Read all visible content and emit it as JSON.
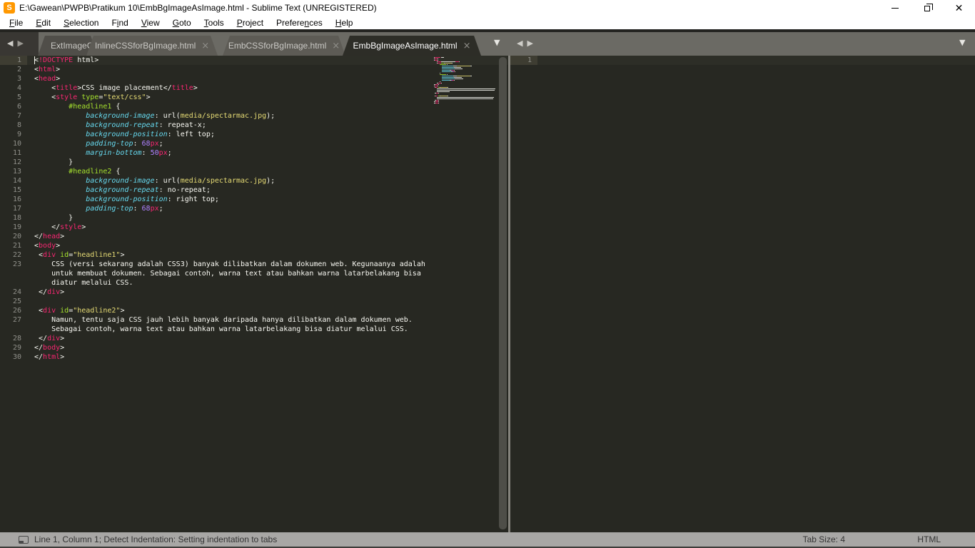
{
  "window": {
    "title": "E:\\Gawean\\PWPB\\Pratikum 10\\EmbBgImageAsImage.html - Sublime Text (UNREGISTERED)",
    "app_icon_letter": "S"
  },
  "icons": {
    "back": "◀",
    "forward": "▶",
    "dropdown": "▼",
    "close": "×"
  },
  "menu": {
    "items": [
      {
        "label": "File",
        "underline": 0
      },
      {
        "label": "Edit",
        "underline": 0
      },
      {
        "label": "Selection",
        "underline": 0
      },
      {
        "label": "Find",
        "underline": 1
      },
      {
        "label": "View",
        "underline": 0
      },
      {
        "label": "Goto",
        "underline": 0
      },
      {
        "label": "Tools",
        "underline": 0
      },
      {
        "label": "Project",
        "underline": 0
      },
      {
        "label": "Preferences",
        "underline": 7
      },
      {
        "label": "Help",
        "underline": 0
      }
    ]
  },
  "tabs": {
    "items": [
      {
        "label": "ExtImageCS",
        "active": false,
        "close_visible": false
      },
      {
        "label": "InlineCSSforBgImage.html",
        "active": false,
        "close_visible": true
      },
      {
        "label": "EmbCSSforBgImage.html",
        "active": false,
        "close_visible": true
      },
      {
        "label": "EmbBgImageAsImage.html",
        "active": true,
        "close_visible": true
      }
    ]
  },
  "editor": {
    "colors": {
      "w": "#f8f8f2",
      "p": "#f92672",
      "g": "#a6e22e",
      "y": "#e6db74",
      "c": "#66d9ef",
      "n": "#ae81ff"
    },
    "rows": [
      {
        "num": "1",
        "current": true,
        "cursor": true,
        "tokens": [
          [
            "w",
            "<"
          ],
          [
            "p",
            "!DOCTYPE"
          ],
          [
            "w",
            " html>"
          ]
        ]
      },
      {
        "num": "2",
        "tokens": [
          [
            "w",
            "<"
          ],
          [
            "p",
            "html"
          ],
          [
            "w",
            ">"
          ]
        ]
      },
      {
        "num": "3",
        "tokens": [
          [
            "w",
            "<"
          ],
          [
            "p",
            "head"
          ],
          [
            "w",
            ">"
          ]
        ]
      },
      {
        "num": "4",
        "tokens": [
          [
            "w",
            "    <"
          ],
          [
            "p",
            "title"
          ],
          [
            "w",
            ">CSS image placement</"
          ],
          [
            "p",
            "title"
          ],
          [
            "w",
            ">"
          ]
        ]
      },
      {
        "num": "5",
        "tokens": [
          [
            "w",
            "    <"
          ],
          [
            "p",
            "style"
          ],
          [
            "w",
            " "
          ],
          [
            "g",
            "type"
          ],
          [
            "w",
            "="
          ],
          [
            "y",
            "\"text/css\""
          ],
          [
            "w",
            ">"
          ]
        ]
      },
      {
        "num": "6",
        "tokens": [
          [
            "w",
            "        "
          ],
          [
            "g",
            "#headline1"
          ],
          [
            "w",
            " {"
          ]
        ]
      },
      {
        "num": "7",
        "tokens": [
          [
            "w",
            "            "
          ],
          [
            "c",
            "background-image"
          ],
          [
            "w",
            ": url("
          ],
          [
            "y",
            "media/spectarmac.jpg"
          ],
          [
            "w",
            ");"
          ]
        ]
      },
      {
        "num": "8",
        "tokens": [
          [
            "w",
            "            "
          ],
          [
            "c",
            "background-repeat"
          ],
          [
            "w",
            ": repeat-x;"
          ]
        ]
      },
      {
        "num": "9",
        "tokens": [
          [
            "w",
            "            "
          ],
          [
            "c",
            "background-position"
          ],
          [
            "w",
            ": left top;"
          ]
        ]
      },
      {
        "num": "10",
        "tokens": [
          [
            "w",
            "            "
          ],
          [
            "c",
            "padding-top"
          ],
          [
            "w",
            ": "
          ],
          [
            "n",
            "68"
          ],
          [
            "p",
            "px"
          ],
          [
            "w",
            ";"
          ]
        ]
      },
      {
        "num": "11",
        "tokens": [
          [
            "w",
            "            "
          ],
          [
            "c",
            "margin-bottom"
          ],
          [
            "w",
            ": "
          ],
          [
            "n",
            "50"
          ],
          [
            "p",
            "px"
          ],
          [
            "w",
            ";"
          ]
        ]
      },
      {
        "num": "12",
        "tokens": [
          [
            "w",
            "        }"
          ]
        ]
      },
      {
        "num": "13",
        "tokens": [
          [
            "w",
            "        "
          ],
          [
            "g",
            "#headline2"
          ],
          [
            "w",
            " {"
          ]
        ]
      },
      {
        "num": "14",
        "tokens": [
          [
            "w",
            "            "
          ],
          [
            "c",
            "background-image"
          ],
          [
            "w",
            ": url("
          ],
          [
            "y",
            "media/spectarmac.jpg"
          ],
          [
            "w",
            ");"
          ]
        ]
      },
      {
        "num": "15",
        "tokens": [
          [
            "w",
            "            "
          ],
          [
            "c",
            "background-repeat"
          ],
          [
            "w",
            ": no-repeat;"
          ]
        ]
      },
      {
        "num": "16",
        "tokens": [
          [
            "w",
            "            "
          ],
          [
            "c",
            "background-position"
          ],
          [
            "w",
            ": right top;"
          ]
        ]
      },
      {
        "num": "17",
        "tokens": [
          [
            "w",
            "            "
          ],
          [
            "c",
            "padding-top"
          ],
          [
            "w",
            ": "
          ],
          [
            "n",
            "68"
          ],
          [
            "p",
            "px"
          ],
          [
            "w",
            ";"
          ]
        ]
      },
      {
        "num": "18",
        "tokens": [
          [
            "w",
            "        }"
          ]
        ]
      },
      {
        "num": "19",
        "tokens": [
          [
            "w",
            "    </"
          ],
          [
            "p",
            "style"
          ],
          [
            "w",
            ">"
          ]
        ]
      },
      {
        "num": "20",
        "tokens": [
          [
            "w",
            "</"
          ],
          [
            "p",
            "head"
          ],
          [
            "w",
            ">"
          ]
        ]
      },
      {
        "num": "21",
        "tokens": [
          [
            "w",
            "<"
          ],
          [
            "p",
            "body"
          ],
          [
            "w",
            ">"
          ]
        ]
      },
      {
        "num": "22",
        "tokens": [
          [
            "w",
            " <"
          ],
          [
            "p",
            "div"
          ],
          [
            "w",
            " "
          ],
          [
            "g",
            "id"
          ],
          [
            "w",
            "="
          ],
          [
            "y",
            "\"headline1\""
          ],
          [
            "w",
            ">"
          ]
        ]
      },
      {
        "num": "23",
        "tokens": [
          [
            "w",
            "    CSS (versi sekarang adalah CSS3) banyak dilibatkan dalam dokumen web. Kegunaanya adalah"
          ]
        ]
      },
      {
        "num": "",
        "tokens": [
          [
            "w",
            "    untuk membuat dokumen. Sebagai contoh, warna text atau bahkan warna latarbelakang bisa"
          ]
        ]
      },
      {
        "num": "",
        "tokens": [
          [
            "w",
            "    diatur melalui CSS."
          ]
        ]
      },
      {
        "num": "24",
        "tokens": [
          [
            "w",
            " </"
          ],
          [
            "p",
            "div"
          ],
          [
            "w",
            ">"
          ]
        ]
      },
      {
        "num": "25",
        "tokens": []
      },
      {
        "num": "26",
        "tokens": [
          [
            "w",
            " <"
          ],
          [
            "p",
            "div"
          ],
          [
            "w",
            " "
          ],
          [
            "g",
            "id"
          ],
          [
            "w",
            "="
          ],
          [
            "y",
            "\"headline2\""
          ],
          [
            "w",
            ">"
          ]
        ]
      },
      {
        "num": "27",
        "tokens": [
          [
            "w",
            "    Namun, tentu saja CSS jauh lebih banyak daripada hanya dilibatkan dalam dokumen web."
          ]
        ]
      },
      {
        "num": "",
        "tokens": [
          [
            "w",
            "    Sebagai contoh, warna text atau bahkan warna latarbelakang bisa diatur melalui CSS."
          ]
        ]
      },
      {
        "num": "28",
        "tokens": [
          [
            "w",
            " </"
          ],
          [
            "p",
            "div"
          ],
          [
            "w",
            ">"
          ]
        ]
      },
      {
        "num": "29",
        "tokens": [
          [
            "w",
            "</"
          ],
          [
            "p",
            "body"
          ],
          [
            "w",
            ">"
          ]
        ]
      },
      {
        "num": "30",
        "tokens": [
          [
            "w",
            "</"
          ],
          [
            "p",
            "html"
          ],
          [
            "w",
            ">"
          ]
        ]
      }
    ]
  },
  "right_pane": {
    "rows": [
      {
        "num": "1",
        "current": true,
        "tokens": []
      }
    ]
  },
  "status_bar": {
    "left_text": "Line 1, Column 1; Detect Indentation: Setting indentation to tabs",
    "tab_size": "Tab Size: 4",
    "syntax": "HTML"
  }
}
